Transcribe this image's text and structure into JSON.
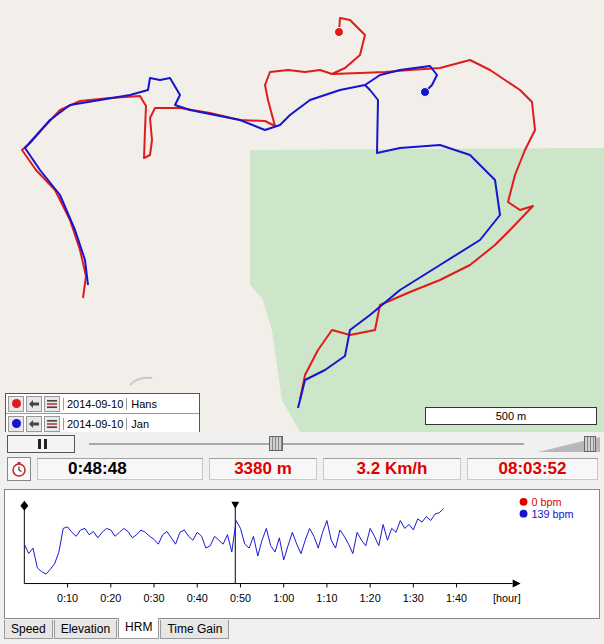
{
  "map": {
    "areas": [
      {
        "kind": "forest",
        "points": [
          [
            250,
            150
          ],
          [
            604,
            148
          ],
          [
            604,
            432
          ],
          [
            300,
            432
          ],
          [
            282,
            400
          ],
          [
            272,
            330
          ],
          [
            262,
            298
          ],
          [
            250,
            285
          ]
        ]
      }
    ],
    "tracks": [
      {
        "date": "2014-09-10",
        "name": "Hans",
        "color": "#e01b1b",
        "visible": true,
        "marker": [
          339,
          32
        ],
        "paths": [
          [
            [
              339,
              32
            ],
            [
              340,
              18
            ],
            [
              350,
              20
            ],
            [
              365,
              35
            ],
            [
              360,
              55
            ],
            [
              345,
              68
            ],
            [
              332,
              74
            ],
            [
              320,
              70
            ],
            [
              305,
              72
            ],
            [
              288,
              70
            ],
            [
              270,
              72
            ],
            [
              265,
              85
            ],
            [
              268,
              100
            ],
            [
              272,
              115
            ],
            [
              275,
              126
            ],
            [
              265,
              121
            ],
            [
              240,
              120
            ],
            [
              210,
              113
            ],
            [
              180,
              108
            ],
            [
              155,
              108
            ],
            [
              150,
              118
            ],
            [
              152,
              140
            ],
            [
              150,
              155
            ],
            [
              144,
              158
            ],
            [
              145,
              130
            ],
            [
              146,
              106
            ],
            [
              140,
              96
            ],
            [
              110,
              98
            ],
            [
              80,
              101
            ],
            [
              60,
              110
            ],
            [
              45,
              126
            ],
            [
              30,
              143
            ],
            [
              22,
              150
            ],
            [
              36,
              170
            ],
            [
              55,
              190
            ],
            [
              70,
              220
            ],
            [
              80,
              250
            ],
            [
              86,
              276
            ],
            [
              83,
              298
            ]
          ],
          [
            [
              332,
              74
            ],
            [
              360,
              73
            ],
            [
              385,
              72
            ],
            [
              410,
              70
            ],
            [
              440,
              68
            ],
            [
              470,
              60
            ],
            [
              490,
              70
            ],
            [
              520,
              90
            ],
            [
              532,
              102
            ],
            [
              535,
              130
            ],
            [
              525,
              150
            ],
            [
              515,
              175
            ],
            [
              508,
              202
            ],
            [
              520,
              210
            ],
            [
              533,
              206
            ],
            [
              510,
              230
            ],
            [
              495,
              245
            ],
            [
              470,
              265
            ],
            [
              440,
              280
            ],
            [
              410,
              292
            ],
            [
              380,
              305
            ],
            [
              375,
              330
            ],
            [
              350,
              335
            ],
            [
              332,
              330
            ],
            [
              318,
              350
            ],
            [
              305,
              375
            ],
            [
              300,
              400
            ]
          ]
        ]
      },
      {
        "date": "2014-09-10",
        "name": "Jan",
        "color": "#1515d0",
        "visible": true,
        "marker": [
          425,
          92
        ],
        "paths": [
          [
            [
              298,
              408
            ],
            [
              305,
              380
            ],
            [
              325,
              370
            ],
            [
              345,
              356
            ],
            [
              350,
              330
            ],
            [
              370,
              315
            ],
            [
              400,
              290
            ],
            [
              440,
              265
            ],
            [
              480,
              240
            ],
            [
              500,
              215
            ],
            [
              495,
              180
            ],
            [
              470,
              155
            ],
            [
              440,
              145
            ],
            [
              400,
              148
            ],
            [
              377,
              153
            ],
            [
              378,
              100
            ],
            [
              370,
              90
            ],
            [
              365,
              85
            ],
            [
              340,
              90
            ],
            [
              310,
              100
            ],
            [
              290,
              115
            ],
            [
              280,
              125
            ],
            [
              265,
              130
            ],
            [
              240,
              120
            ],
            [
              190,
              110
            ],
            [
              175,
              105
            ],
            [
              180,
              95
            ],
            [
              170,
              78
            ],
            [
              160,
              80
            ],
            [
              150,
              78
            ],
            [
              148,
              90
            ],
            [
              130,
              95
            ],
            [
              100,
              100
            ],
            [
              70,
              105
            ],
            [
              50,
              120
            ],
            [
              25,
              148
            ],
            [
              40,
              170
            ],
            [
              60,
              195
            ],
            [
              75,
              230
            ],
            [
              85,
              260
            ],
            [
              88,
              285
            ]
          ],
          [
            [
              365,
              85
            ],
            [
              380,
              75
            ],
            [
              400,
              70
            ],
            [
              430,
              66
            ],
            [
              437,
              75
            ],
            [
              432,
              85
            ],
            [
              425,
              92
            ]
          ]
        ]
      }
    ],
    "scale": {
      "label": "500 m"
    }
  },
  "playback": {
    "playing": true,
    "position": {
      "level": 0.43
    },
    "zoom": {
      "level": 0.84
    }
  },
  "readouts": [
    {
      "name": "elapsed",
      "value": "0:48:48",
      "color": "#000000"
    },
    {
      "name": "distance",
      "value": "3380 m",
      "color": "#e00000"
    },
    {
      "name": "speed",
      "value": "3.2 Km/h",
      "color": "#e00000"
    },
    {
      "name": "clock",
      "value": "08:03:52",
      "color": "#e00000"
    }
  ],
  "chart": {
    "ticks": [
      {
        "label": "0:10",
        "minutes": 10
      },
      {
        "label": "0:20",
        "minutes": 20
      },
      {
        "label": "0:30",
        "minutes": 30
      },
      {
        "label": "0:40",
        "minutes": 40
      },
      {
        "label": "0:50",
        "minutes": 50
      },
      {
        "label": "1:00",
        "minutes": 60
      },
      {
        "label": "1:10",
        "minutes": 70
      },
      {
        "label": "1:20",
        "minutes": 80
      },
      {
        "label": "1:30",
        "minutes": 90
      },
      {
        "label": "1:40",
        "minutes": 100
      }
    ],
    "unit": "[hour]",
    "cursor_minutes": 48.8,
    "series": [
      {
        "name": "Hans",
        "legend": "0 bpm",
        "color": "#e00000",
        "values": []
      },
      {
        "name": "Jan",
        "legend": "139 bpm",
        "color": "#1515d0",
        "values": [
          130,
          118,
          125,
          100,
          95,
          92,
          98,
          105,
          120,
          150,
          152,
          145,
          140,
          148,
          150,
          142,
          146,
          138,
          145,
          150,
          148,
          140,
          145,
          150,
          146,
          138,
          142,
          148,
          145,
          140,
          136,
          130,
          142,
          146,
          138,
          130,
          145,
          148,
          140,
          135,
          145,
          140,
          125,
          128,
          140,
          135,
          130,
          142,
          120,
          160,
          150,
          130,
          125,
          140,
          115,
          135,
          150,
          128,
          120,
          138,
          110,
          128,
          145,
          130,
          118,
          135,
          150,
          140,
          125,
          145,
          160,
          135,
          125,
          148,
          140,
          130,
          118,
          145,
          135,
          128,
          150,
          140,
          128,
          155,
          135,
          150,
          145,
          160,
          150,
          155,
          148,
          162,
          158,
          165,
          160,
          168,
          170,
          175
        ]
      }
    ]
  },
  "tabs": [
    {
      "label": "Speed",
      "selected": false
    },
    {
      "label": "Elevation",
      "selected": false
    },
    {
      "label": "HRM",
      "selected": true
    },
    {
      "label": "Time Gain",
      "selected": false
    }
  ]
}
